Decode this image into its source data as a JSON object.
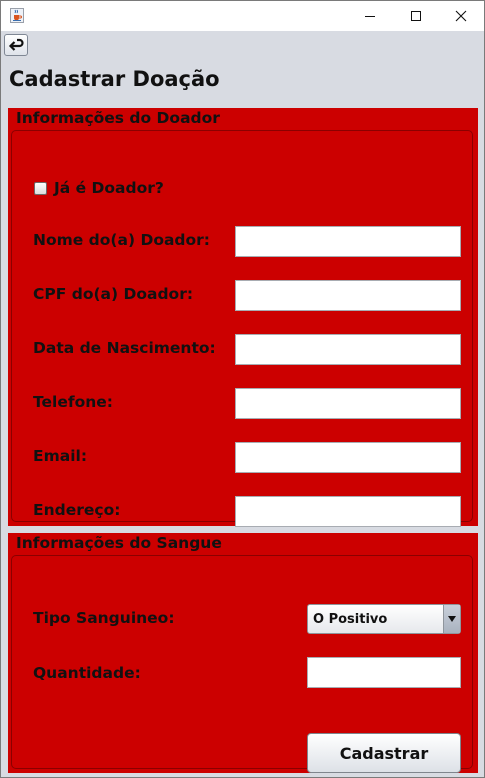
{
  "window": {
    "icon": "java-cup-icon",
    "controls": [
      "minimize-icon",
      "maximize-icon",
      "close-icon"
    ]
  },
  "toolbar": {
    "back_icon": "return-arrow-icon"
  },
  "page": {
    "title": "Cadastrar Doação"
  },
  "colors": {
    "panel_bg": "#cc0000",
    "window_bg": "#d8dbe2"
  },
  "donor_section": {
    "legend": "Informações do Doador",
    "already_donor_label": "Já é Doador?",
    "already_donor_checked": false,
    "fields": [
      {
        "label": "Nome do(a) Doador:",
        "value": ""
      },
      {
        "label": "CPF do(a) Doador:",
        "value": ""
      },
      {
        "label": "Data de Nascimento:",
        "value": ""
      },
      {
        "label": "Telefone:",
        "value": ""
      },
      {
        "label": "Email:",
        "value": ""
      },
      {
        "label": "Endereço:",
        "value": ""
      }
    ]
  },
  "blood_section": {
    "legend": "Informações do Sangue",
    "blood_type_label": "Tipo Sanguineo:",
    "blood_type_value": "O Positivo",
    "quantity_label": "Quantidade:",
    "quantity_value": "",
    "submit_label": "Cadastrar"
  }
}
